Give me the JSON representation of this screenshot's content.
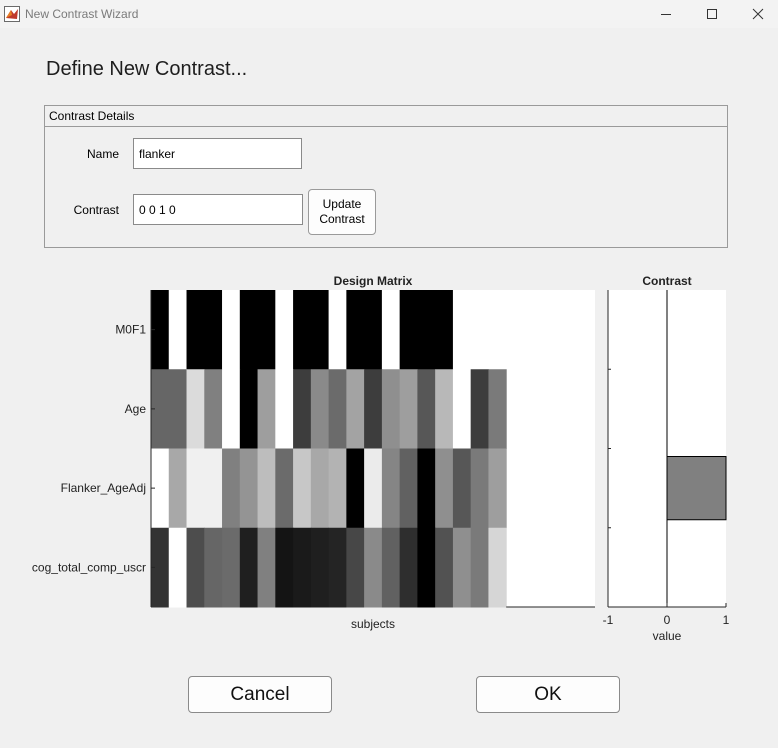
{
  "window": {
    "title": "New Contrast Wizard",
    "icon": "matlab-icon",
    "controls": [
      "minimize-icon",
      "maximize-icon",
      "close-icon"
    ]
  },
  "heading": "Define New Contrast...",
  "details": {
    "legend": "Contrast Details",
    "name_label": "Name",
    "name_value": "flanker",
    "contrast_label": "Contrast",
    "contrast_value": "0 0 1 0",
    "update_button": "Update\nContrast"
  },
  "design_matrix": {
    "title": "Design Matrix",
    "xlabel": "subjects",
    "regressors": [
      "M0F1",
      "Age",
      "Flanker_AgeAdj",
      "cog_total_comp_uscr"
    ],
    "n_subjects": 20,
    "n_columns": 25,
    "colormap": "gray",
    "cells": [
      [
        0.0,
        1.0,
        0.0,
        0.0,
        1.0,
        0.0,
        0.0,
        1.0,
        0.0,
        0.0,
        1.0,
        0.0,
        0.0,
        1.0,
        0.0,
        0.0,
        0.0,
        1.0,
        1.0,
        1.0
      ],
      [
        0.4,
        0.4,
        0.86,
        0.5,
        1.0,
        0.0,
        0.62,
        1.0,
        0.24,
        0.54,
        0.42,
        0.64,
        0.24,
        0.56,
        0.62,
        0.34,
        0.72,
        1.0,
        0.24,
        0.48
      ],
      [
        1.0,
        0.66,
        0.94,
        0.94,
        0.5,
        0.58,
        0.74,
        0.42,
        0.78,
        0.66,
        0.7,
        0.0,
        0.92,
        0.52,
        0.38,
        0.0,
        0.56,
        0.34,
        0.48,
        0.62
      ],
      [
        0.2,
        1.0,
        0.3,
        0.4,
        0.42,
        0.12,
        0.5,
        0.08,
        0.1,
        0.12,
        0.14,
        0.28,
        0.54,
        0.38,
        0.18,
        0.0,
        0.32,
        0.56,
        0.48,
        0.84
      ]
    ]
  },
  "contrast_plot": {
    "title": "Contrast",
    "xlabel": "value",
    "xlim": [
      -1,
      1
    ],
    "xticks": [
      "-1",
      "0",
      "1"
    ],
    "values": [
      0,
      0,
      1,
      0
    ],
    "bar_color": "#808080"
  },
  "buttons": {
    "cancel": "Cancel",
    "ok": "OK"
  }
}
